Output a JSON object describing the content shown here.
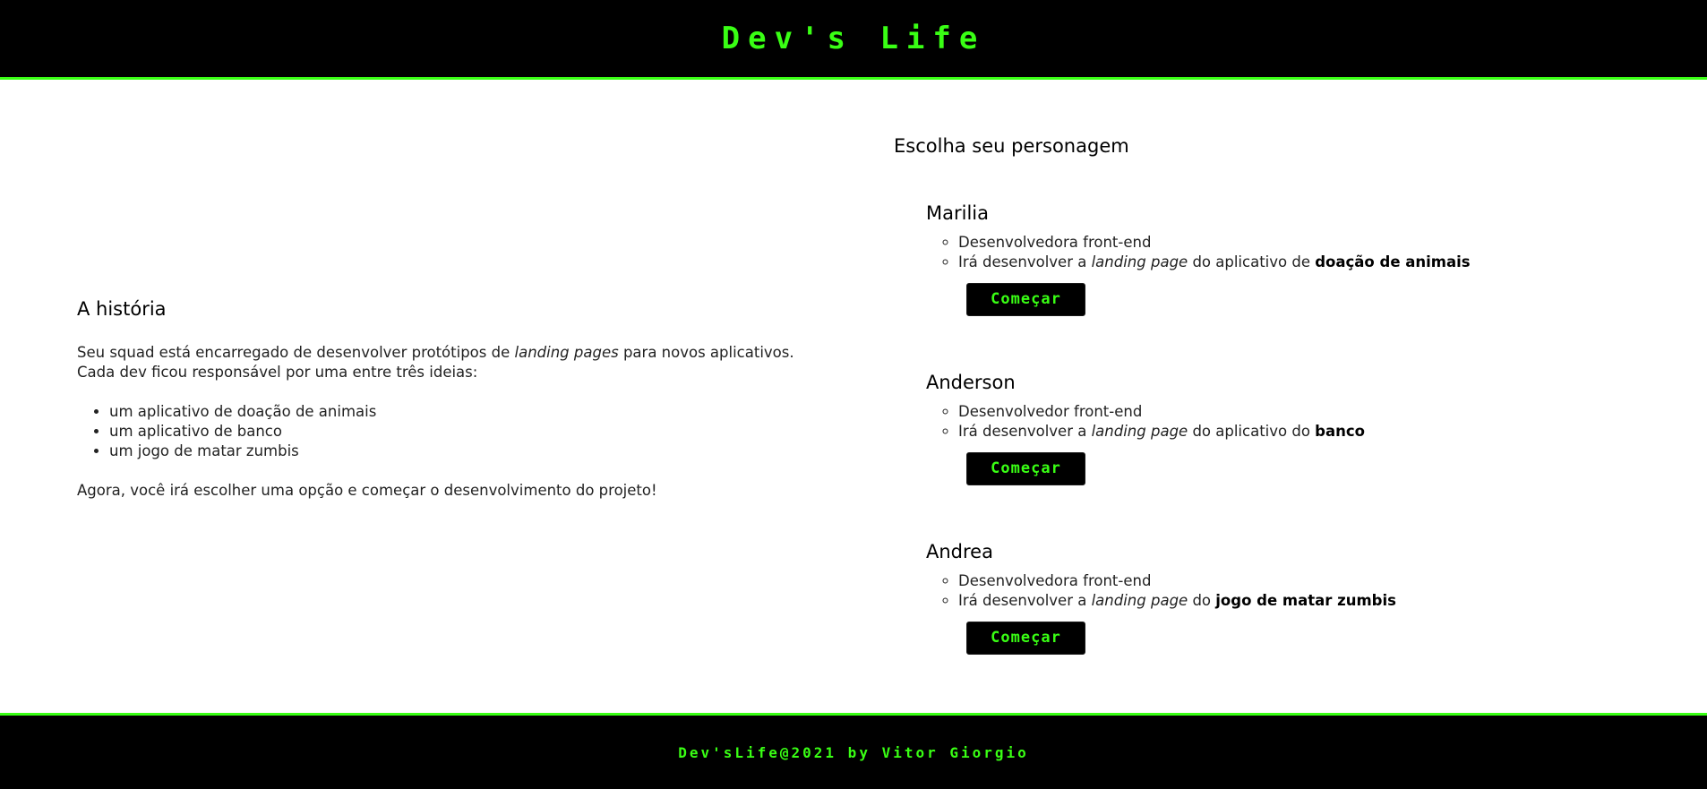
{
  "header": {
    "title": "Dev's Life"
  },
  "story": {
    "heading": "A história",
    "intro_before": "Seu squad está encarregado de desenvolver protótipos de ",
    "intro_em": "landing pages",
    "intro_after": " para novos aplicativos. Cada dev ficou responsável por uma entre três ideias:",
    "ideas": [
      "um aplicativo de doação de animais",
      "um aplicativo de banco",
      "um jogo de matar zumbis"
    ],
    "outro": "Agora, você irá escolher uma opção e começar o desenvolvimento do projeto!"
  },
  "characters": {
    "heading": "Escolha seu personagem",
    "list": [
      {
        "name": "Marilia",
        "role": "Desenvolvedora front-end",
        "task_before": "Irá desenvolver a ",
        "task_em": "landing page",
        "task_mid": " do aplicativo de ",
        "task_bold": "doação de animais",
        "button": "Começar"
      },
      {
        "name": "Anderson",
        "role": "Desenvolvedor front-end",
        "task_before": "Irá desenvolver a ",
        "task_em": "landing page",
        "task_mid": " do aplicativo do ",
        "task_bold": "banco",
        "button": "Começar"
      },
      {
        "name": "Andrea",
        "role": "Desenvolvedora front-end",
        "task_before": "Irá desenvolver a ",
        "task_em": "landing page",
        "task_mid": " do ",
        "task_bold": "jogo de matar zumbis",
        "button": "Começar"
      }
    ]
  },
  "footer": {
    "text": "Dev'sLife@2021 by Vitor Giorgio"
  },
  "colors": {
    "accent": "#39ff14",
    "background": "#000000",
    "surface": "#ffffff"
  }
}
